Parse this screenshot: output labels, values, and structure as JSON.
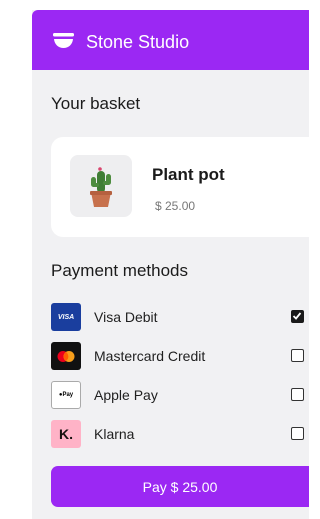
{
  "header": {
    "brand": "Stone Studio",
    "logo_icon": "bowl-icon",
    "color": "#9b28f3"
  },
  "basket": {
    "title": "Your basket",
    "item": {
      "name": "Plant pot",
      "price": "$ 25.00",
      "image_icon": "cactus-pot-icon"
    }
  },
  "payment": {
    "title": "Payment methods",
    "methods": [
      {
        "label": "Visa Debit",
        "icon_text": "VISA",
        "icon": "visa-icon",
        "selected": true
      },
      {
        "label": "Mastercard Credit",
        "icon": "mastercard-icon",
        "selected": false
      },
      {
        "label": "Apple Pay",
        "icon_text": "Pay",
        "icon": "apple-pay-icon",
        "selected": false
      },
      {
        "label": "Klarna",
        "icon_text": "K.",
        "icon": "klarna-icon",
        "selected": false
      }
    ]
  },
  "pay_button": {
    "label": "Pay $ 25.00"
  }
}
